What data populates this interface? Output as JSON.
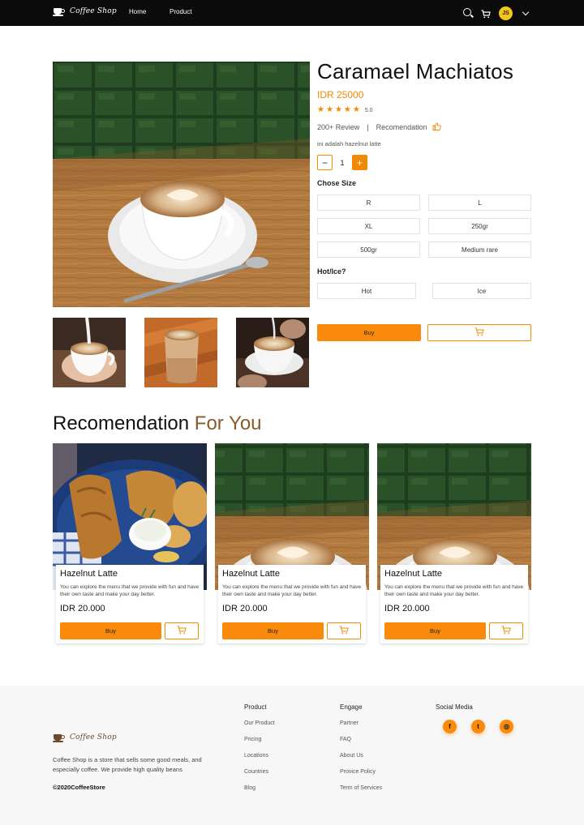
{
  "nav": {
    "brand": "Coffee Shop",
    "links": [
      "Home",
      "Product"
    ],
    "avatar_initials": "JS",
    "icons": [
      "search-icon",
      "cart-icon",
      "chevron-down-icon"
    ]
  },
  "product": {
    "title": "Caramael Machiatos",
    "price": "IDR 25000",
    "rating": "5.0",
    "stars": 5,
    "reviews": "200+ Review",
    "separator": "|",
    "recommendation": "Recomendation",
    "description": "ini adalah hazelnut latte",
    "quantity": "1",
    "minus": "−",
    "plus": "+",
    "size_label": "Chose Size",
    "sizes": [
      "R",
      "L",
      "XL",
      "250gr",
      "500gr",
      "Medium rare"
    ],
    "temp_label": "Hot/Ice?",
    "temps": [
      "Hot",
      "Ice"
    ],
    "buy_label": "Buy"
  },
  "recommendation": {
    "title_main": "Recomendation",
    "title_accent": "For You",
    "cards": [
      {
        "title": "Hazelnut Latte",
        "desc": "You can explore the menu that we provide with fun and have their own taste and make your day better.",
        "price": "IDR 20.000",
        "buy": "Buy",
        "image": "fried-food"
      },
      {
        "title": "Hazelnut Latte",
        "desc": "You can explore the menu that we provide with fun and have their own taste and make your day better.",
        "price": "IDR 20.000",
        "buy": "Buy",
        "image": "latte"
      },
      {
        "title": "Hazelnut Latte",
        "desc": "You can explore the menu that we provide with fun and have their own taste and make your day better.",
        "price": "IDR 20.000",
        "buy": "Buy",
        "image": "latte"
      }
    ]
  },
  "footer": {
    "brand": "Coffee Shop",
    "about": "Coffee Shop is a store that sells some good meals, and especially coffee. We provide high quality beans",
    "copyright": "©2020CoffeeStore",
    "columns": [
      {
        "title": "Product",
        "links": [
          "Our Product",
          "Pricing",
          "Locations",
          "Countries",
          "Blog"
        ]
      },
      {
        "title": "Engage",
        "links": [
          "Partner",
          "FAQ",
          "About Us",
          "Provice Policy",
          "Term of Services"
        ]
      }
    ],
    "social_title": "Social Media",
    "social": [
      {
        "name": "facebook-icon",
        "glyph": "f"
      },
      {
        "name": "twitter-icon",
        "glyph": "t"
      },
      {
        "name": "instagram-icon",
        "glyph": "◎"
      }
    ]
  },
  "colors": {
    "accent": "#f98a0b",
    "accent_text": "#f08a00",
    "brown": "#8b5a2b",
    "nav_bg": "#0b0b0b"
  }
}
